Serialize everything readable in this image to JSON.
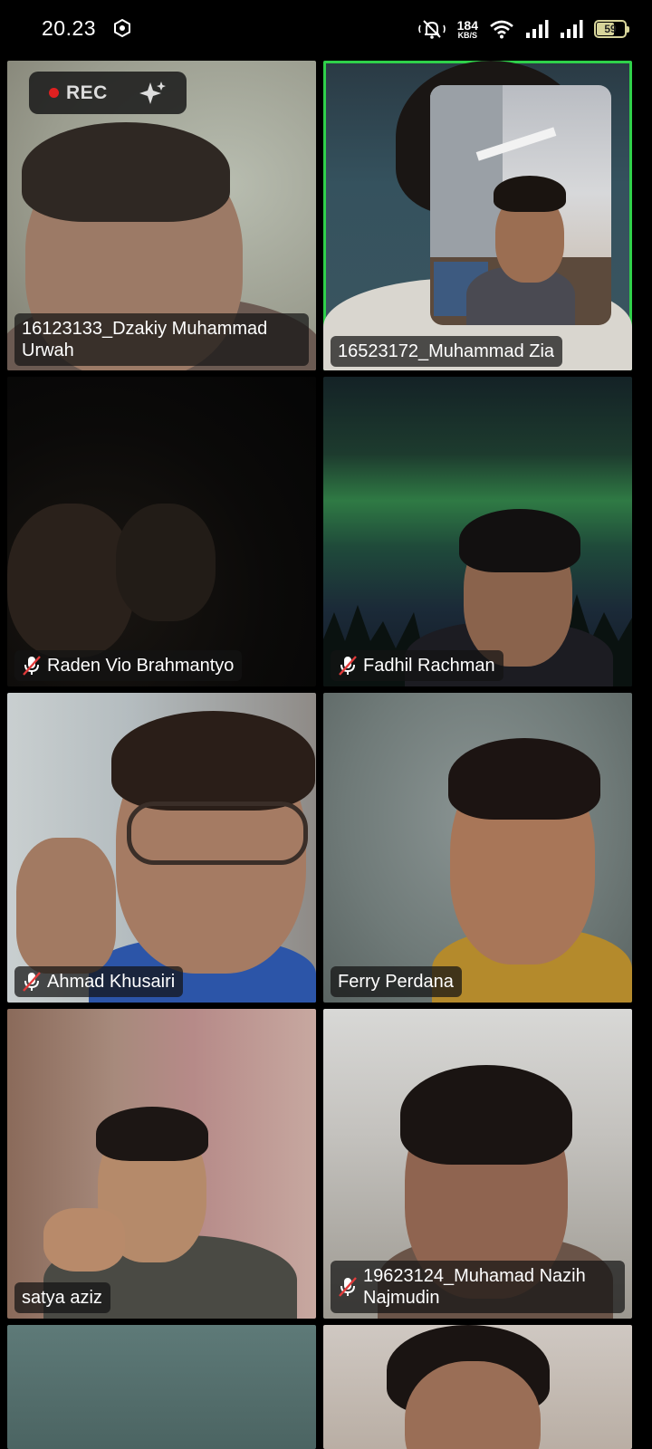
{
  "status_bar": {
    "time": "20.23",
    "network_speed_value": "184",
    "network_speed_unit": "KB/S",
    "battery_level": "59",
    "icons": [
      "screen-record-icon",
      "mute-bell-icon",
      "wifi-icon",
      "signal-icon",
      "signal-icon",
      "battery-icon"
    ]
  },
  "recording": {
    "label": "REC",
    "indicator_color": "#e02020",
    "ai_icon": "sparkle-icon"
  },
  "active_speaker_color": "#2fd04a",
  "participants": [
    {
      "name": "16123133_Dzakiy Muhammad Urwah",
      "muted": false
    },
    {
      "name": "16523172_Muhammad Zia",
      "muted": false,
      "active_speaker": true
    },
    {
      "name": "Raden Vio Brahmantyo",
      "muted": true
    },
    {
      "name": "Fadhil Rachman",
      "muted": true
    },
    {
      "name": "Ahmad Khusairi",
      "muted": true
    },
    {
      "name": "Ferry Perdana",
      "muted": false
    },
    {
      "name": "satya aziz",
      "muted": false
    },
    {
      "name": "19623124_Muhamad Nazih Najmudin",
      "muted": true
    }
  ]
}
